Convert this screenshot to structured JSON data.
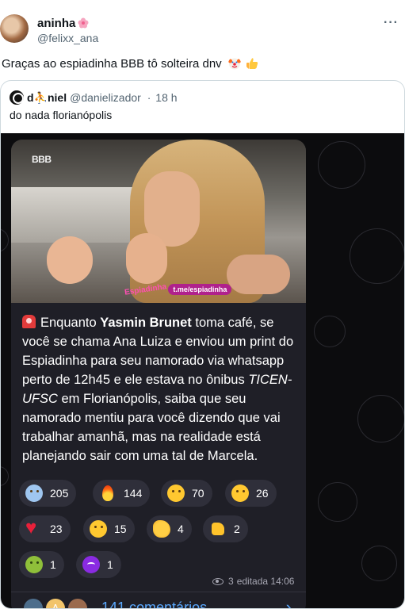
{
  "author": {
    "display_name": "aninha",
    "handle": "@felixx_ana",
    "flower_icon": "flower-icon",
    "more_icon": "more-options-icon",
    "more_label": "···"
  },
  "tweet": {
    "text": "Graças ao espiadinha BBB tô solteira dnv",
    "emojis": [
      "clown-face-icon",
      "thumbs-up-icon"
    ]
  },
  "quoted_tweet": {
    "display_name": "d⛹niel",
    "handle": "@danielizador",
    "separator": "·",
    "time": "18 h",
    "text": "do nada florianópolis",
    "media": {
      "logo": "BBB",
      "watermark_brand": "Espiadinha",
      "watermark_link": "t.me/espiadinha",
      "message": {
        "intro": "Enquanto ",
        "bold_name": "Yasmin Brunet",
        "part2": " toma café, se você se chama Ana Luiza e enviou um print do Espiadinha para seu namorado via whatsapp perto de 12h45 e ele estava no ônibus ",
        "italic_bus": "TICEN-UFSC",
        "part3": " em Florianópolis, saiba que seu namorado mentiu para você dizendo que vai trabalhar amanhã, mas na realidade está planejando sair com uma tal de Marcela."
      },
      "reactions": [
        {
          "icon": "scream-face-icon",
          "count": "205"
        },
        {
          "icon": "fire-icon",
          "count": "144"
        },
        {
          "icon": "rofl-face-icon",
          "count": "70"
        },
        {
          "icon": "grinning-face-icon",
          "count": "26"
        },
        {
          "icon": "red-heart-icon",
          "count": "23"
        },
        {
          "icon": "thinking-face-icon",
          "count": "15"
        },
        {
          "icon": "clapping-hands-icon",
          "count": "4"
        },
        {
          "icon": "thumbs-up-icon",
          "count": "2"
        },
        {
          "icon": "nauseated-face-icon",
          "count": "1"
        },
        {
          "icon": "smiling-devil-icon",
          "count": "1"
        }
      ],
      "views": "3",
      "edited_time": "editada 14:06",
      "comments_label": "141 comentários",
      "comments_chevron": "›",
      "commenter_initial": "A"
    }
  }
}
